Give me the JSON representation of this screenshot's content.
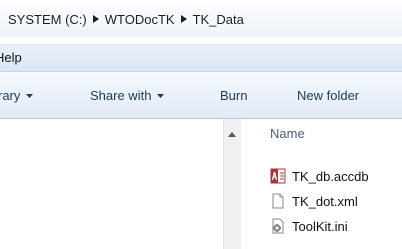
{
  "address_bar": {
    "crumbs": [
      "SYSTEM (C:)",
      "WTODocTK",
      "TK_Data"
    ]
  },
  "menu": {
    "help": "Help"
  },
  "toolbar": {
    "library": "rary",
    "share_with": "Share with",
    "burn": "Burn",
    "new_folder": "New folder"
  },
  "file_list": {
    "column_name": "Name",
    "files": [
      {
        "name": "TK_db.accdb",
        "icon": "access-database-icon"
      },
      {
        "name": "TK_dot.xml",
        "icon": "document-icon"
      },
      {
        "name": "ToolKit.ini",
        "icon": "settings-file-icon"
      }
    ]
  },
  "colors": {
    "toolbar_text": "#1e395b",
    "access_red": "#a4373a"
  }
}
